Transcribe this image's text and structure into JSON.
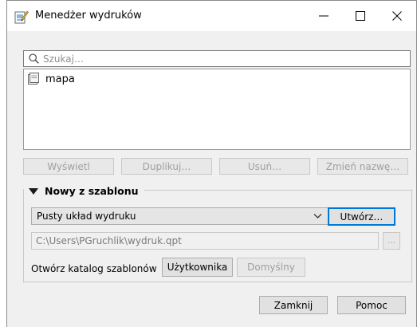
{
  "window": {
    "title": "Menedżer wydruków",
    "minimize_icon": "minimize-icon",
    "maximize_icon": "maximize-icon",
    "close_icon": "close-icon"
  },
  "search": {
    "placeholder": "Szukaj…",
    "value": ""
  },
  "layouts": [
    {
      "name": "mapa",
      "icon": "layout-document-icon"
    }
  ],
  "actions": {
    "show": "Wyświetl",
    "duplicate": "Duplikuj…",
    "remove": "Usuń…",
    "rename": "Zmień nazwę…"
  },
  "new_from_template": {
    "header": "Nowy z szablonu",
    "template_selected": "Pusty układ wydruku",
    "create_button": "Utwórz…",
    "path": "C:\\Users\\PGruchlik\\wydruk.qpt",
    "browse_button": "…",
    "open_dir_label": "Otwórz katalog szablonów",
    "user_button": "Użytkownika",
    "default_button": "Domyślny"
  },
  "footer": {
    "close": "Zamknij",
    "help": "Pomoc"
  }
}
